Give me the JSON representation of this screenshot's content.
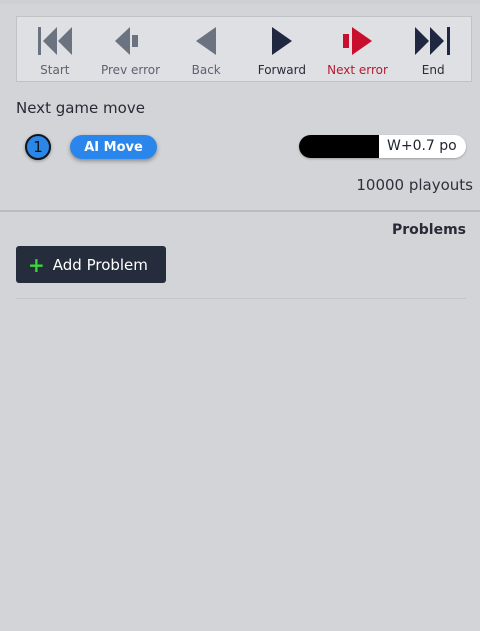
{
  "navigation": {
    "buttons": [
      {
        "label": "Start",
        "icon": "skip-to-start-icon"
      },
      {
        "label": "Prev error",
        "icon": "prev-error-icon"
      },
      {
        "label": "Back",
        "icon": "back-icon"
      },
      {
        "label": "Forward",
        "icon": "forward-icon"
      },
      {
        "label": "Next error",
        "icon": "next-error-icon"
      },
      {
        "label": "End",
        "icon": "skip-to-end-icon"
      }
    ]
  },
  "next_move": {
    "title": "Next game move",
    "move_number": "1",
    "ai_move_label": "AI Move",
    "score_text": "W+0.7 po",
    "black_fraction": 0.48,
    "playouts": "10000 playouts"
  },
  "problems": {
    "title": "Problems",
    "add_button_label": "Add Problem",
    "plus_symbol": "+"
  },
  "colors": {
    "background": "#d3d4d7",
    "error_red": "#c8102e",
    "primary_blue": "#2a86ea",
    "dark_button": "#252d3d",
    "plus_green": "#3ad53a"
  }
}
